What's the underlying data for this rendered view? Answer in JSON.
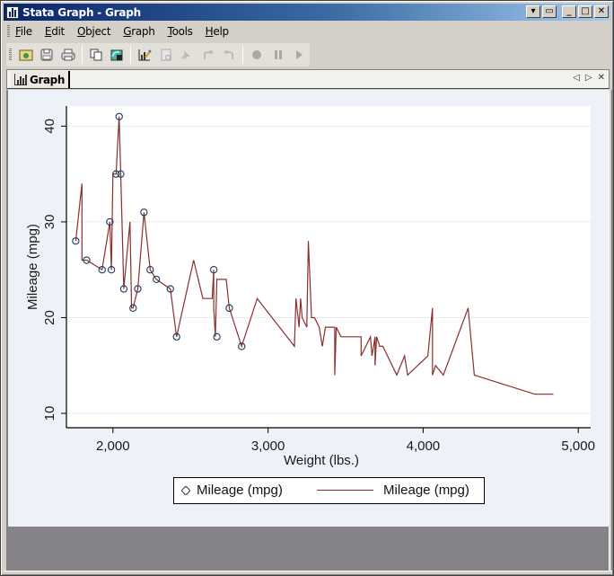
{
  "window": {
    "title": "Stata Graph - Graph",
    "controls": [
      "menu-dropdown",
      "restore-pane",
      "minimize",
      "maximize",
      "close"
    ]
  },
  "menubar": {
    "items": [
      {
        "label": "File",
        "accel": "F"
      },
      {
        "label": "Edit",
        "accel": "E"
      },
      {
        "label": "Object",
        "accel": "O"
      },
      {
        "label": "Graph",
        "accel": "G"
      },
      {
        "label": "Tools",
        "accel": "T"
      },
      {
        "label": "Help",
        "accel": "H"
      }
    ]
  },
  "toolbar": {
    "groups": [
      [
        {
          "name": "open-graph",
          "icon": "folder-open-icon",
          "enabled": true
        },
        {
          "name": "save-graph",
          "icon": "floppy-disk-icon",
          "enabled": true
        },
        {
          "name": "print-graph",
          "icon": "printer-icon",
          "enabled": true
        }
      ],
      [
        {
          "name": "copy-graph",
          "icon": "copy-icon",
          "enabled": true
        },
        {
          "name": "rename-graph",
          "icon": "graph-rename-icon",
          "enabled": true
        }
      ],
      [
        {
          "name": "start-graph-editor",
          "icon": "graph-editor-icon",
          "enabled": true
        },
        {
          "name": "object-browser",
          "icon": "object-browser-icon",
          "enabled": false
        },
        {
          "name": "pointer-tool",
          "icon": "pointer-icon",
          "enabled": false
        },
        {
          "name": "undo",
          "icon": "undo-icon",
          "enabled": false
        },
        {
          "name": "redo",
          "icon": "redo-icon",
          "enabled": false
        }
      ],
      [
        {
          "name": "record",
          "icon": "record-icon",
          "enabled": false
        },
        {
          "name": "pause",
          "icon": "pause-icon",
          "enabled": false
        },
        {
          "name": "play",
          "icon": "play-icon",
          "enabled": false
        }
      ]
    ]
  },
  "tabs": [
    {
      "label": "Graph",
      "active": true
    }
  ],
  "tab_nav": {
    "prev": "◁",
    "next": "▷",
    "close": "✕"
  },
  "colors": {
    "line": "#8b2e2e",
    "marker": "#1a3a5c",
    "plot_bg": "#ffffff",
    "graph_bg": "#eef2f8",
    "grid": "#e8ebf0",
    "bottom_area": "#858387"
  },
  "chart_data": {
    "type": "line",
    "title": "",
    "xlabel": "Weight (lbs.)",
    "ylabel": "Mileage (mpg)",
    "xlim": [
      1700,
      5080
    ],
    "ylim": [
      8.5,
      42.1
    ],
    "xticks": [
      2000,
      3000,
      4000,
      5000
    ],
    "xtick_labels": [
      "2,000",
      "3,000",
      "4,000",
      "5,000"
    ],
    "yticks": [
      10,
      20,
      30,
      40
    ],
    "ytick_labels": [
      "10",
      "20",
      "30",
      "40"
    ],
    "grid": true,
    "legend": {
      "placement": "bottom",
      "entries": [
        {
          "label": "Mileage (mpg)",
          "kind": "marker"
        },
        {
          "label": "Mileage (mpg)",
          "kind": "line"
        }
      ]
    },
    "series": [
      {
        "name": "Mileage (mpg)",
        "kind": "scatter",
        "marker": "hollow-circle",
        "x": [
          1760,
          1830,
          1930,
          1980,
          1990,
          2020,
          2040,
          2050,
          2070,
          2130,
          2160,
          2200,
          2240,
          2280,
          2370,
          2410,
          2650,
          2670,
          2750,
          2830
        ],
        "y": [
          28,
          26,
          25,
          30,
          25,
          35,
          41,
          35,
          23,
          21,
          23,
          31,
          25,
          24,
          23,
          18,
          25,
          18,
          21,
          17
        ]
      },
      {
        "name": "Mileage (mpg)",
        "kind": "line",
        "x": [
          1760,
          1800,
          1800,
          1830,
          1930,
          1980,
          1990,
          1990,
          2000,
          2020,
          2040,
          2050,
          2070,
          2110,
          2120,
          2130,
          2160,
          2200,
          2200,
          2240,
          2280,
          2370,
          2410,
          2520,
          2580,
          2640,
          2650,
          2650,
          2660,
          2670,
          2690,
          2730,
          2750,
          2750,
          2830,
          2930,
          3170,
          3180,
          3200,
          3210,
          3220,
          3250,
          3260,
          3270,
          3280,
          3300,
          3330,
          3350,
          3370,
          3400,
          3420,
          3430,
          3430,
          3440,
          3470,
          3600,
          3600,
          3660,
          3670,
          3690,
          3690,
          3700,
          3720,
          3740,
          3830,
          3880,
          3900,
          4030,
          4060,
          4060,
          4080,
          4130,
          4290,
          4330,
          4720,
          4840
        ],
        "y": [
          28,
          34,
          26,
          26,
          25,
          30,
          25,
          25,
          35,
          35,
          41,
          35,
          23,
          30,
          21,
          21,
          23,
          31,
          31,
          25,
          24,
          23,
          18,
          26,
          22,
          22,
          25,
          21,
          18,
          24,
          24,
          24,
          21,
          21,
          17,
          22,
          17,
          22,
          19,
          22,
          20,
          19,
          28,
          24,
          20,
          20,
          19,
          17,
          19,
          19,
          19,
          19,
          14,
          19,
          18,
          18,
          16,
          18,
          16,
          18,
          15,
          18,
          17,
          17,
          14,
          16,
          14,
          16,
          21,
          14,
          15,
          14,
          21,
          14,
          12,
          12
        ]
      }
    ]
  }
}
